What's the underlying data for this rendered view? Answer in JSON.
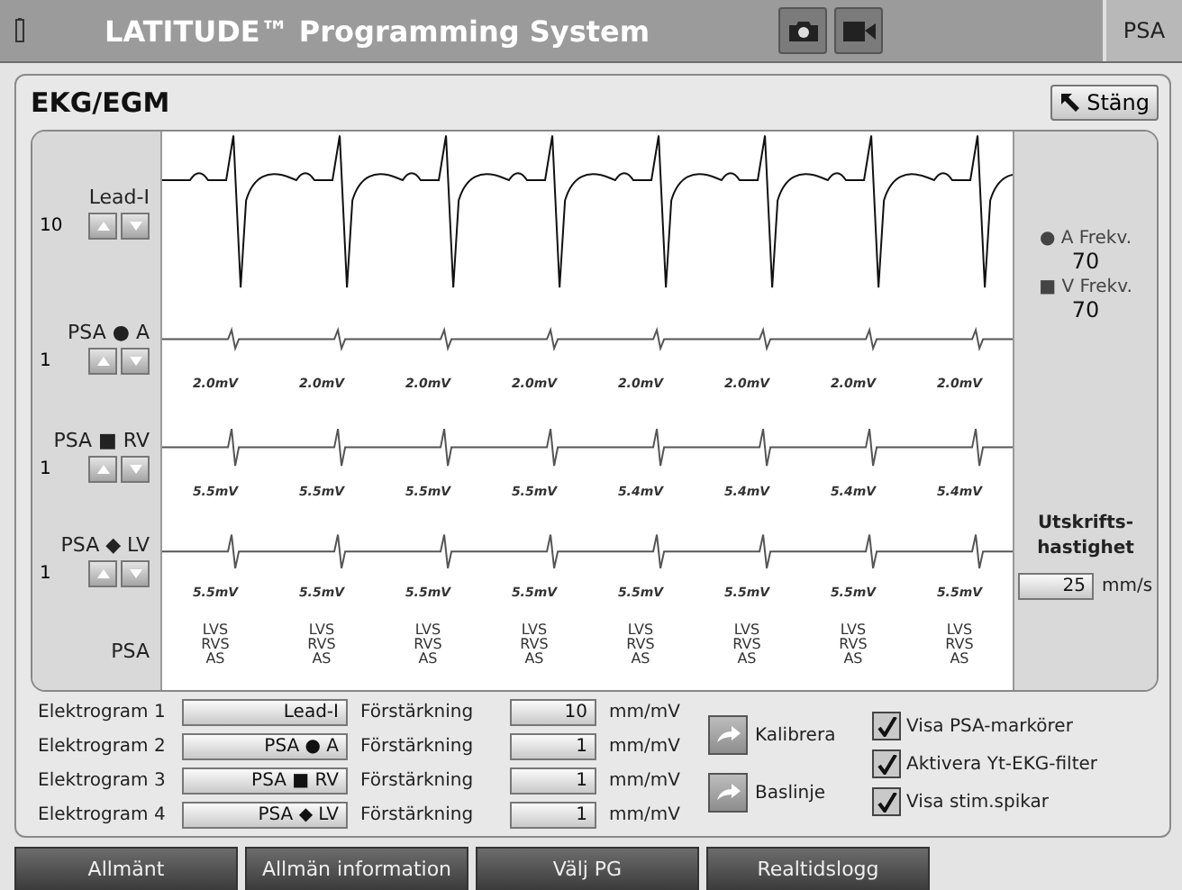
{
  "header": {
    "title": "LATITUDE™ Programming System",
    "mode_button": "PSA"
  },
  "panel": {
    "title": "EKG/EGM",
    "close_button": "Stäng"
  },
  "channels": [
    {
      "kind": "surface",
      "label": "Lead-I",
      "gain": "10"
    },
    {
      "kind": "atrial",
      "label": "PSA ● A",
      "gain": "1",
      "amplitudes": [
        "2.0mV",
        "2.0mV",
        "2.0mV",
        "2.0mV",
        "2.0mV",
        "2.0mV",
        "2.0mV",
        "2.0mV"
      ]
    },
    {
      "kind": "ventricular",
      "label": "PSA ■ RV",
      "gain": "1",
      "amplitudes": [
        "5.5mV",
        "5.5mV",
        "5.5mV",
        "5.5mV",
        "5.4mV",
        "5.4mV",
        "5.4mV",
        "5.4mV"
      ]
    },
    {
      "kind": "ventricular",
      "label": "PSA ◆ LV",
      "gain": "1",
      "amplitudes": [
        "5.5mV",
        "5.5mV",
        "5.5mV",
        "5.5mV",
        "5.5mV",
        "5.5mV",
        "5.5mV",
        "5.5mV"
      ]
    }
  ],
  "marker_channel": {
    "label": "PSA",
    "beats": [
      [
        "LVS",
        "RVS",
        "AS"
      ],
      [
        "LVS",
        "RVS",
        "AS"
      ],
      [
        "LVS",
        "RVS",
        "AS"
      ],
      [
        "LVS",
        "RVS",
        "AS"
      ],
      [
        "LVS",
        "RVS",
        "AS"
      ],
      [
        "LVS",
        "RVS",
        "AS"
      ],
      [
        "LVS",
        "RVS",
        "AS"
      ],
      [
        "LVS",
        "RVS",
        "AS"
      ]
    ]
  },
  "rates": [
    {
      "label": "● A Frekv.",
      "value": "70"
    },
    {
      "label": "■ V Frekv.",
      "value": "70"
    }
  ],
  "print_speed": {
    "label_lines": [
      "Utskrifts-",
      "hastighet"
    ],
    "value": "25",
    "unit": "mm/s"
  },
  "electrograms": [
    {
      "label": "Elektrogram 1",
      "source": "Lead-I",
      "gain_label": "Förstärkning",
      "gain": "10",
      "unit": "mm/mV"
    },
    {
      "label": "Elektrogram 2",
      "source": "PSA ● A",
      "gain_label": "Förstärkning",
      "gain": "1",
      "unit": "mm/mV"
    },
    {
      "label": "Elektrogram 3",
      "source": "PSA ■ RV",
      "gain_label": "Förstärkning",
      "gain": "1",
      "unit": "mm/mV"
    },
    {
      "label": "Elektrogram 4",
      "source": "PSA ◆ LV",
      "gain_label": "Förstärkning",
      "gain": "1",
      "unit": "mm/mV"
    }
  ],
  "actions": [
    {
      "label": "Kalibrera"
    },
    {
      "label": "Baslinje"
    }
  ],
  "options": [
    {
      "label": "Visa PSA-markörer",
      "checked": true
    },
    {
      "label": "Aktivera Yt-EKG-filter",
      "checked": true
    },
    {
      "label": "Visa stim.spikar",
      "checked": true
    }
  ],
  "tabs": [
    {
      "label": "Allmänt",
      "selected": false
    },
    {
      "label": "Allmän information",
      "selected": false
    },
    {
      "label": "Välj PG",
      "selected": false
    },
    {
      "label": "Realtidslogg",
      "selected": false
    }
  ]
}
